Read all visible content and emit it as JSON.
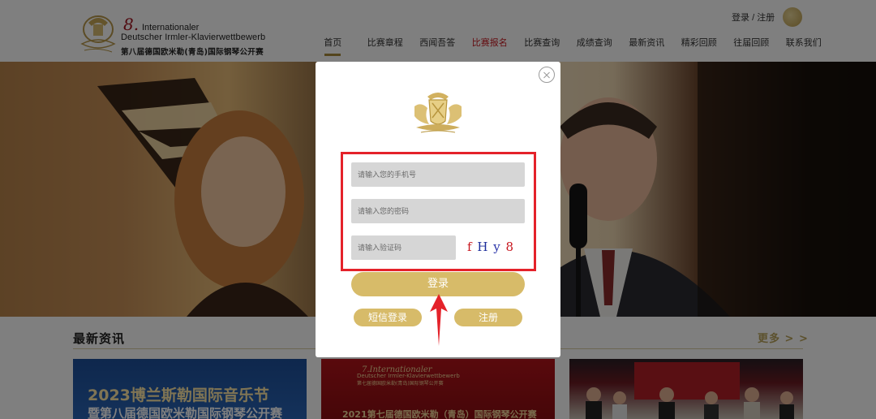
{
  "header": {
    "logo_number": "8.",
    "logo_line1": "Internationaler",
    "logo_line2": "Deutscher Irmler-Klavierwettbewerb",
    "logo_cn": "第八届德国欧米勒(青岛)国际钢琴公开赛",
    "login_link": "登录",
    "separator": "/",
    "register_link": "注册"
  },
  "nav": {
    "items": [
      "首页",
      "比赛章程",
      "西闻吾答",
      "比赛报名",
      "比赛查询",
      "成绩查询",
      "最新资讯",
      "精彩回顾",
      "往届回顾",
      "联系我们"
    ]
  },
  "news": {
    "title": "最新资讯",
    "more": "更多 > >",
    "card1_line1": "2023博兰斯勒国际音乐节",
    "card1_line2": "暨第八届德国欧米勒国际钢琴公开赛",
    "card2_line1": "7.Internationaler",
    "card2_line2": "Deutscher Irmler-Klavierwettbewerb",
    "card2_line3": "第七届德国欧米勒(青岛)国际钢琴公开赛",
    "card2_line4": "2021第七届德国欧米勒（青岛）国际钢琴公开赛"
  },
  "modal": {
    "phone_placeholder": "请输入您的手机号",
    "password_placeholder": "请输入您的密码",
    "code_placeholder": "请输入验证码",
    "captcha": [
      "f",
      "H",
      "y",
      "8"
    ],
    "login_label": "登录",
    "sms_label": "短信登录",
    "register_label": "注册"
  },
  "colors": {
    "gold": "#d7bb69",
    "annotation_red": "#e4222a",
    "nav_active_red": "#c7161e"
  }
}
